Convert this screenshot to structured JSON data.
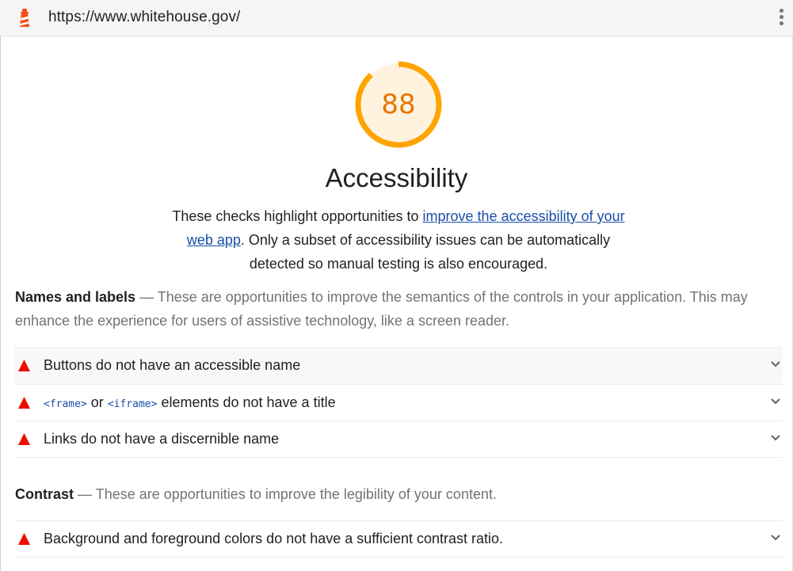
{
  "toolbar": {
    "url": "https://www.whitehouse.gov/",
    "logo_icon": "lighthouse-icon",
    "menu_icon": "more-vert-icon"
  },
  "score": {
    "value": 88,
    "fraction": 0.88,
    "color": "#ffa400",
    "text_color": "#e67700",
    "fill": "#fff3e0"
  },
  "category": {
    "title": "Accessibility",
    "description_prefix": "These checks highlight opportunities to ",
    "description_link": "improve the accessibility of your web app",
    "description_suffix": ". Only a subset of accessibility issues can be automatically detected so manual testing is also encouraged."
  },
  "groups": [
    {
      "title": "Names and labels",
      "separator": " — ",
      "description": "These are opportunities to improve the semantics of the controls in your application. This may enhance the experience for users of assistive technology, like a screen reader.",
      "audits": [
        {
          "label": "Buttons do not have an accessible name"
        },
        {
          "code1": "<frame>",
          "mid": " or ",
          "code2": "<iframe>",
          "label": " elements do not have a title"
        },
        {
          "label": "Links do not have a discernible name"
        }
      ]
    },
    {
      "title": "Contrast",
      "separator": " — ",
      "description": "These are opportunities to improve the legibility of your content.",
      "audits": [
        {
          "label": "Background and foreground colors do not have a sufficient contrast ratio."
        }
      ]
    }
  ],
  "colors": {
    "fail": "#eb0f00",
    "link": "#1a4ea8",
    "chevron": "#616161"
  },
  "icons": {
    "fail": "fail-triangle-icon",
    "expand": "chevron-down-icon"
  }
}
